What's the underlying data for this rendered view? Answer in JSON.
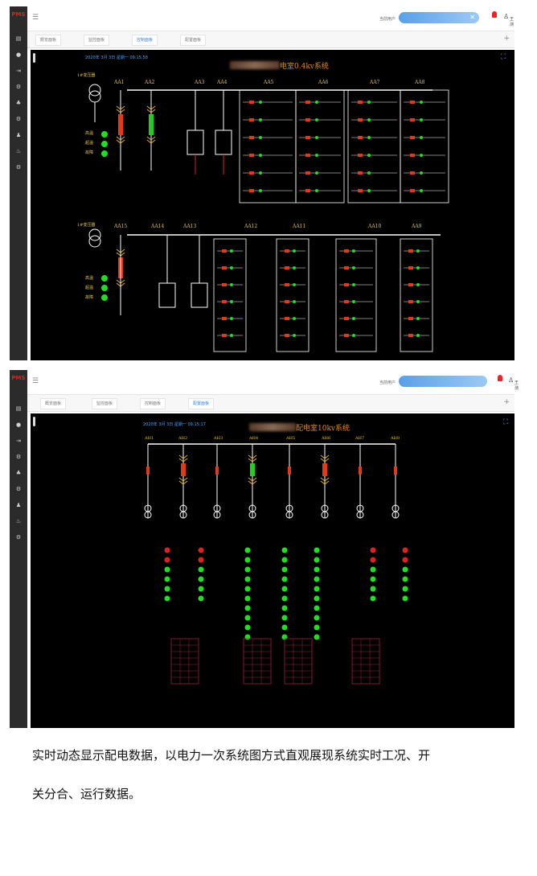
{
  "screenshots": [
    {
      "logo": "PMS",
      "topbar": {
        "user_label": "当前用户",
        "username": "王测"
      },
      "tabs": [
        {
          "label": "概览面板",
          "active": false
        },
        {
          "label": "监控面板",
          "active": false
        },
        {
          "label": "控制面板",
          "active": true
        },
        {
          "label": "配置面板",
          "active": false
        }
      ],
      "panel": {
        "title": "电室0.4kv系统",
        "datetime": "2020年 3月 3日 星期一 09:15:58",
        "top_cabinets": [
          "AA1",
          "AA2",
          "AA3",
          "AA4",
          "AA5",
          "AA6",
          "AA7",
          "AA8"
        ],
        "bottom_cabinets": [
          "AA15",
          "AA14",
          "AA13",
          "AA12",
          "AA11",
          "AA10",
          "AA9"
        ],
        "transformer_label": "1#变压器",
        "status_labels": [
          "高温",
          "超温",
          "故障"
        ]
      }
    },
    {
      "logo": "PMS",
      "topbar": {
        "user_label": "当前用户",
        "username": "王测"
      },
      "tabs": [
        {
          "label": "概览面板",
          "active": false
        },
        {
          "label": "监控面板",
          "active": false
        },
        {
          "label": "控制面板",
          "active": false
        },
        {
          "label": "配置面板",
          "active": true
        }
      ],
      "panel": {
        "title": "配电室10kv系统",
        "datetime": "2020年 3月 3日 星期一 09:15:17",
        "cabinets": [
          "AH1",
          "AH2",
          "AH3",
          "AH4",
          "AH5",
          "AH6",
          "AH7",
          "AH8"
        ]
      }
    }
  ],
  "caption": {
    "line1": "实时动态显示配电数据，以电力一次系统图方式直观展现系统实时工况、开",
    "line2": "关分合、运行数据。"
  },
  "colors": {
    "panel_bg": "#000000",
    "bus_line": "#ffffff",
    "title": "#e08a1e",
    "label": "#e0c050",
    "status_green": "#22dd22",
    "status_red": "#dd2222",
    "breaker_closed": "#e03a1a",
    "breaker_open": "#22cc22",
    "accent_blue": "#3b82d6"
  }
}
